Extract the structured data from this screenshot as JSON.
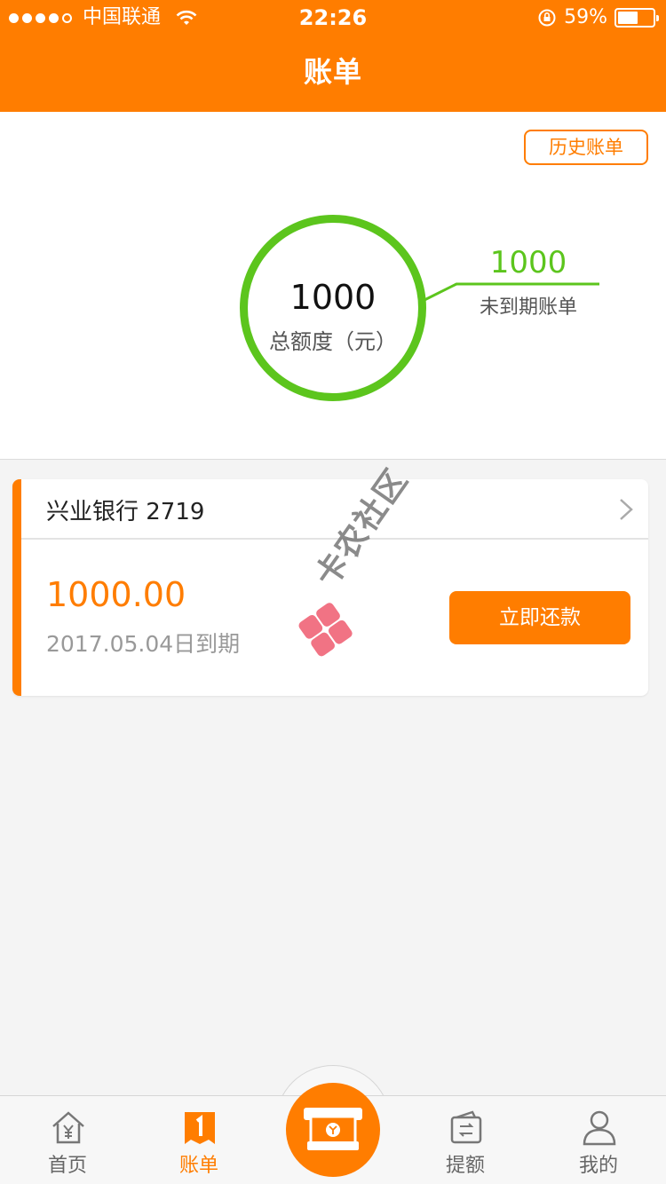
{
  "status_bar": {
    "carrier": "中国联通",
    "time": "22:26",
    "battery_percent": "59%",
    "battery_level": 0.59
  },
  "header": {
    "title": "账单"
  },
  "summary": {
    "history_button": "历史账单",
    "total_value": "1000",
    "total_label": "总额度（元）",
    "unexpired_value": "1000",
    "unexpired_label": "未到期账单"
  },
  "bill_card": {
    "bank": "兴业银行 2719",
    "amount": "1000.00",
    "due_date": "2017.05.04日到期",
    "pay_button": "立即还款"
  },
  "watermark": {
    "text": "卡农社区"
  },
  "tabbar": {
    "home_label": "首页",
    "bill_label": "账单",
    "quota_label": "提额",
    "mine_label": "我的"
  },
  "icons": {
    "signal": "signal-dots-icon",
    "wifi": "wifi-icon",
    "rotation_lock": "rotation-lock-icon",
    "battery": "battery-icon",
    "chevron": "chevron-right-icon",
    "home": "home-yen-icon",
    "bill": "bill-icon",
    "center": "cash-icon",
    "quota": "wallet-icon",
    "mine": "person-icon"
  },
  "colors": {
    "brand_orange": "#ff7d00",
    "ring_green": "#5cc51d",
    "background": "#f4f4f4"
  }
}
